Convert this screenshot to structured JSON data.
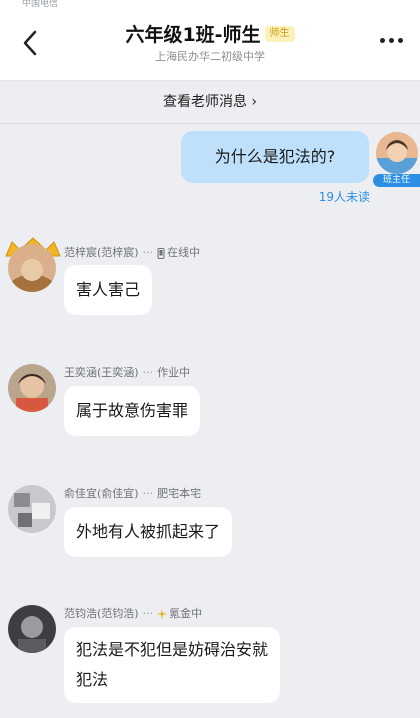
{
  "status_bar": {
    "text": "中国电信"
  },
  "header": {
    "title": "六年级1班-师生",
    "badge": "师生",
    "subtitle": "上海民办华二初级中学",
    "back_icon": "chevron-left-icon",
    "more_icon": "more-dots-icon"
  },
  "notice": {
    "label": "查看老师消息 ›"
  },
  "colors": {
    "my_bubble": "#bfe0fb",
    "accent": "#2b8fe6",
    "badge_bg": "#fdf0b8",
    "badge_text": "#c79a10",
    "background": "#eceef2"
  },
  "my_message": {
    "text": "为什么是犯法的?",
    "role_tag": "班主任",
    "unread": "19人未读"
  },
  "messages": [
    {
      "name": "范梓宸(范梓宸)",
      "status": "在线中",
      "status_icon": "phone-icon",
      "text": "害人害己"
    },
    {
      "name": "王奕涵(王奕涵)",
      "status": "作业中",
      "status_icon": "dots-icon",
      "text": "属于故意伤害罪"
    },
    {
      "name": "俞佳宜(俞佳宜)",
      "status": "肥宅本宅",
      "status_icon": "dots-icon",
      "text": "外地有人被抓起来了"
    },
    {
      "name": "范钧浩(范钧浩)",
      "status": "氪金中",
      "status_icon": "sparkle-icon",
      "text_line1": "犯法是不犯但是妨碍治安就",
      "text_line2": "犯法"
    }
  ]
}
